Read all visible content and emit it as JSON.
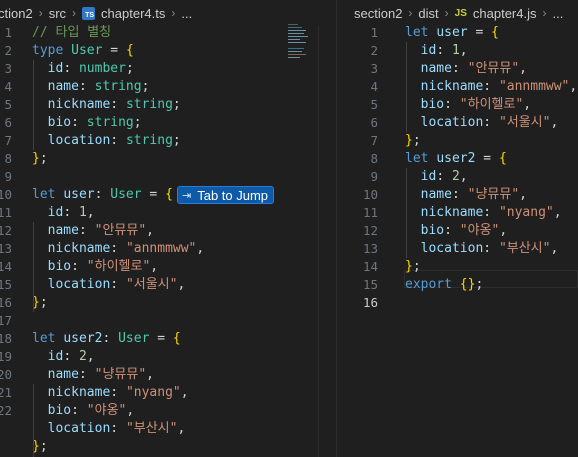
{
  "left_pane": {
    "breadcrumb": [
      "ction2",
      "src",
      "chapter4.ts",
      "..."
    ],
    "file_type_icon": "typescript-icon",
    "line_numbers": [
      "1",
      "2",
      "3",
      "4",
      "5",
      "6",
      "7",
      "8",
      "9",
      "10",
      "11",
      "12",
      "13",
      "14",
      "15",
      "16",
      "17",
      "18",
      "19",
      "20",
      "21",
      "22"
    ],
    "lines": [
      [
        [
          "c",
          "// 타입 별칭"
        ]
      ],
      [
        [
          "k",
          "type"
        ],
        [
          "pl",
          " "
        ],
        [
          "t",
          "User"
        ],
        [
          "pl",
          " = "
        ],
        [
          "br",
          "{"
        ]
      ],
      [
        [
          "pl",
          "  "
        ],
        [
          "p",
          "id"
        ],
        [
          "pl",
          ": "
        ],
        [
          "t",
          "number"
        ],
        [
          "pl",
          ";"
        ]
      ],
      [
        [
          "pl",
          "  "
        ],
        [
          "p",
          "name"
        ],
        [
          "pl",
          ": "
        ],
        [
          "t",
          "string"
        ],
        [
          "pl",
          ";"
        ]
      ],
      [
        [
          "pl",
          "  "
        ],
        [
          "p",
          "nickname"
        ],
        [
          "pl",
          ": "
        ],
        [
          "t",
          "string"
        ],
        [
          "pl",
          ";"
        ]
      ],
      [
        [
          "pl",
          "  "
        ],
        [
          "p",
          "bio"
        ],
        [
          "pl",
          ": "
        ],
        [
          "t",
          "string"
        ],
        [
          "pl",
          ";"
        ]
      ],
      [
        [
          "pl",
          "  "
        ],
        [
          "p",
          "location"
        ],
        [
          "pl",
          ": "
        ],
        [
          "t",
          "string"
        ],
        [
          "pl",
          ";"
        ]
      ],
      [
        [
          "br",
          "}"
        ],
        [
          "pl",
          ";"
        ]
      ],
      [],
      [
        [
          "k",
          "let"
        ],
        [
          "pl",
          " "
        ],
        [
          "p",
          "user"
        ],
        [
          "pl",
          ": "
        ],
        [
          "t",
          "User"
        ],
        [
          "pl",
          " = "
        ],
        [
          "br",
          "{"
        ]
      ],
      [
        [
          "pl",
          "  "
        ],
        [
          "p",
          "id"
        ],
        [
          "pl",
          ": "
        ],
        [
          "n",
          "1"
        ],
        [
          "pl",
          ","
        ]
      ],
      [
        [
          "pl",
          "  "
        ],
        [
          "p",
          "name"
        ],
        [
          "pl",
          ": "
        ],
        [
          "s",
          "\"안뮤뮤\""
        ],
        [
          "pl",
          ","
        ]
      ],
      [
        [
          "pl",
          "  "
        ],
        [
          "p",
          "nickname"
        ],
        [
          "pl",
          ": "
        ],
        [
          "s",
          "\"annmmww\""
        ],
        [
          "pl",
          ","
        ]
      ],
      [
        [
          "pl",
          "  "
        ],
        [
          "p",
          "bio"
        ],
        [
          "pl",
          ": "
        ],
        [
          "s",
          "\"하이헬로\""
        ],
        [
          "pl",
          ","
        ]
      ],
      [
        [
          "pl",
          "  "
        ],
        [
          "p",
          "location"
        ],
        [
          "pl",
          ": "
        ],
        [
          "s",
          "\"서울시\""
        ],
        [
          "pl",
          ","
        ]
      ],
      [
        [
          "br",
          "}"
        ],
        [
          "pl",
          ";"
        ]
      ],
      [],
      [
        [
          "k",
          "let"
        ],
        [
          "pl",
          " "
        ],
        [
          "p",
          "user2"
        ],
        [
          "pl",
          ": "
        ],
        [
          "t",
          "User"
        ],
        [
          "pl",
          " = "
        ],
        [
          "br",
          "{"
        ]
      ],
      [
        [
          "pl",
          "  "
        ],
        [
          "p",
          "id"
        ],
        [
          "pl",
          ": "
        ],
        [
          "n",
          "2"
        ],
        [
          "pl",
          ","
        ]
      ],
      [
        [
          "pl",
          "  "
        ],
        [
          "p",
          "name"
        ],
        [
          "pl",
          ": "
        ],
        [
          "s",
          "\"냥뮤뮤\""
        ],
        [
          "pl",
          ","
        ]
      ],
      [
        [
          "pl",
          "  "
        ],
        [
          "p",
          "nickname"
        ],
        [
          "pl",
          ": "
        ],
        [
          "s",
          "\"nyang\""
        ],
        [
          "pl",
          ","
        ]
      ],
      [
        [
          "pl",
          "  "
        ],
        [
          "p",
          "bio"
        ],
        [
          "pl",
          ": "
        ],
        [
          "s",
          "\"야옹\""
        ],
        [
          "pl",
          ","
        ]
      ],
      [
        [
          "pl",
          "  "
        ],
        [
          "p",
          "location"
        ],
        [
          "pl",
          ": "
        ],
        [
          "s",
          "\"부산시\""
        ],
        [
          "pl",
          ","
        ]
      ],
      [
        [
          "br",
          "}"
        ],
        [
          "pl",
          ";"
        ]
      ]
    ],
    "tab_to_jump": "Tab to Jump"
  },
  "right_pane": {
    "breadcrumb": [
      "section2",
      "dist",
      "chapter4.js",
      "..."
    ],
    "file_type_icon": "javascript-icon",
    "file_type_label": "JS",
    "active_line": 16,
    "line_numbers": [
      "1",
      "2",
      "3",
      "4",
      "5",
      "6",
      "7",
      "8",
      "9",
      "10",
      "11",
      "12",
      "13",
      "14",
      "15",
      "16"
    ],
    "lines": [
      [
        [
          "k",
          "let"
        ],
        [
          "pl",
          " "
        ],
        [
          "p",
          "user"
        ],
        [
          "pl",
          " = "
        ],
        [
          "br",
          "{"
        ]
      ],
      [
        [
          "pl",
          "  "
        ],
        [
          "p",
          "id"
        ],
        [
          "pl",
          ": "
        ],
        [
          "n",
          "1"
        ],
        [
          "pl",
          ","
        ]
      ],
      [
        [
          "pl",
          "  "
        ],
        [
          "p",
          "name"
        ],
        [
          "pl",
          ": "
        ],
        [
          "s",
          "\"안뮤뮤\""
        ],
        [
          "pl",
          ","
        ]
      ],
      [
        [
          "pl",
          "  "
        ],
        [
          "p",
          "nickname"
        ],
        [
          "pl",
          ": "
        ],
        [
          "s",
          "\"annmmww\""
        ],
        [
          "pl",
          ","
        ]
      ],
      [
        [
          "pl",
          "  "
        ],
        [
          "p",
          "bio"
        ],
        [
          "pl",
          ": "
        ],
        [
          "s",
          "\"하이헬로\""
        ],
        [
          "pl",
          ","
        ]
      ],
      [
        [
          "pl",
          "  "
        ],
        [
          "p",
          "location"
        ],
        [
          "pl",
          ": "
        ],
        [
          "s",
          "\"서울시\""
        ],
        [
          "pl",
          ","
        ]
      ],
      [
        [
          "br",
          "}"
        ],
        [
          "pl",
          ";"
        ]
      ],
      [
        [
          "k",
          "let"
        ],
        [
          "pl",
          " "
        ],
        [
          "p",
          "user2"
        ],
        [
          "pl",
          " = "
        ],
        [
          "br",
          "{"
        ]
      ],
      [
        [
          "pl",
          "  "
        ],
        [
          "p",
          "id"
        ],
        [
          "pl",
          ": "
        ],
        [
          "n",
          "2"
        ],
        [
          "pl",
          ","
        ]
      ],
      [
        [
          "pl",
          "  "
        ],
        [
          "p",
          "name"
        ],
        [
          "pl",
          ": "
        ],
        [
          "s",
          "\"냥뮤뮤\""
        ],
        [
          "pl",
          ","
        ]
      ],
      [
        [
          "pl",
          "  "
        ],
        [
          "p",
          "nickname"
        ],
        [
          "pl",
          ": "
        ],
        [
          "s",
          "\"nyang\""
        ],
        [
          "pl",
          ","
        ]
      ],
      [
        [
          "pl",
          "  "
        ],
        [
          "p",
          "bio"
        ],
        [
          "pl",
          ": "
        ],
        [
          "s",
          "\"야옹\""
        ],
        [
          "pl",
          ","
        ]
      ],
      [
        [
          "pl",
          "  "
        ],
        [
          "p",
          "location"
        ],
        [
          "pl",
          ": "
        ],
        [
          "s",
          "\"부산시\""
        ],
        [
          "pl",
          ","
        ]
      ],
      [
        [
          "br",
          "}"
        ],
        [
          "pl",
          ";"
        ]
      ],
      [
        [
          "k",
          "export"
        ],
        [
          "pl",
          " "
        ],
        [
          "br",
          "{}"
        ],
        [
          "pl",
          ";"
        ]
      ],
      []
    ]
  },
  "colors": {
    "background": "#1f1f1f",
    "keyword": "#569cd6",
    "type": "#4ec9b0",
    "property": "#9cdcfe",
    "string": "#ce9178",
    "number": "#b5cea8",
    "comment": "#6a9955",
    "bracket": "#ffd700",
    "tab_jump_bg": "#0e5aa8"
  }
}
